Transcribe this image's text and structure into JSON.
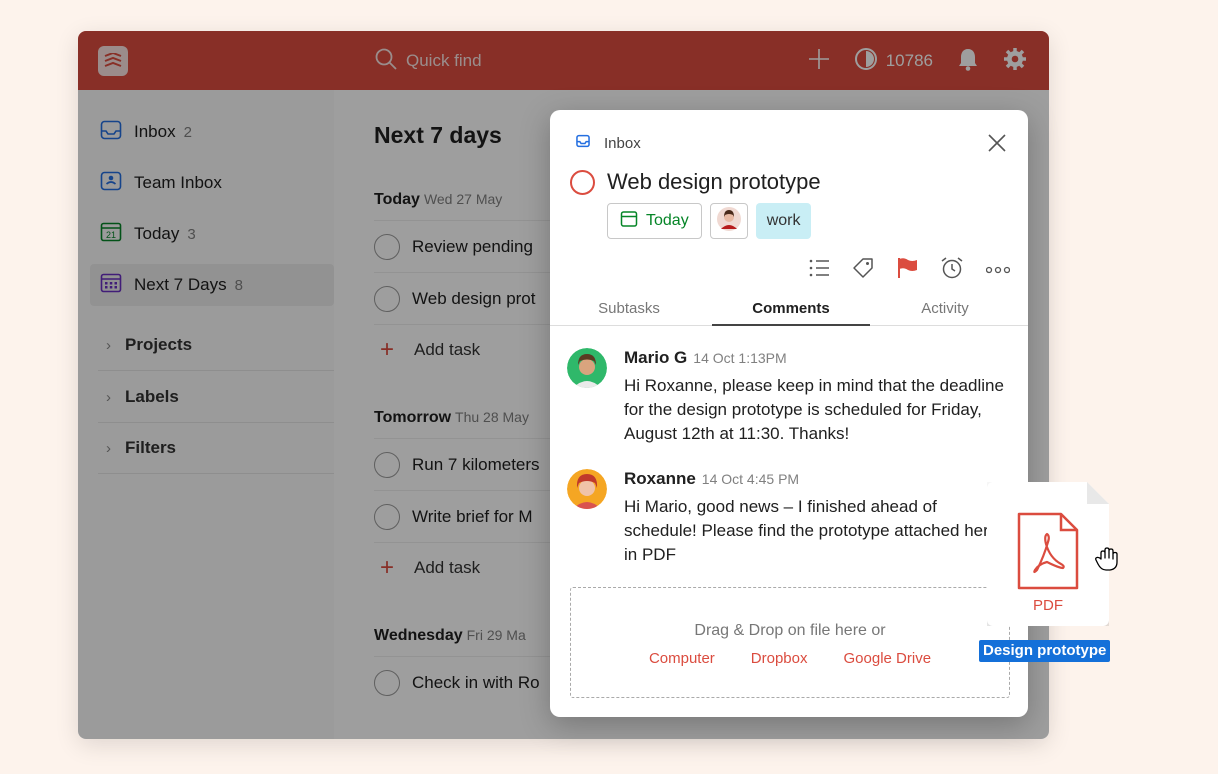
{
  "topbar": {
    "search_placeholder": "Quick find",
    "karma_points": "10786",
    "icons": [
      "app-logo-icon",
      "search-icon",
      "plus-icon",
      "karma-icon",
      "bell-icon",
      "gear-icon"
    ]
  },
  "sidebar": {
    "items": [
      {
        "label": "Inbox",
        "count": "2"
      },
      {
        "label": "Team Inbox",
        "count": ""
      },
      {
        "label": "Today",
        "count": "3"
      },
      {
        "label": "Next 7 Days",
        "count": "8"
      }
    ],
    "groups": [
      "Projects",
      "Labels",
      "Filters"
    ]
  },
  "main": {
    "title": "Next 7 days",
    "days": [
      {
        "name": "Today",
        "date": "Wed 27 May",
        "tasks": [
          "Review pending",
          "Web design prot"
        ]
      },
      {
        "name": "Tomorrow",
        "date": "Thu 28 May",
        "tasks": [
          "Run 7 kilometers",
          "Write brief for M"
        ]
      },
      {
        "name": "Wednesday",
        "date": "Fri 29 Ma",
        "tasks": [
          "Check in with Ro"
        ]
      }
    ],
    "add_task_label": "Add task"
  },
  "modal": {
    "project": "Inbox",
    "task_title": "Web design prototype",
    "due_chip": "Today",
    "label_chip": "work",
    "tabs": [
      "Subtasks",
      "Comments",
      "Activity"
    ],
    "active_tab": "Comments",
    "comments": [
      {
        "author": "Mario G",
        "time": "14 Oct 1:13PM",
        "text": "Hi Roxanne, please keep in mind that the deadline for the design prototype is scheduled for Friday, August 12th at 11:30. Thanks!"
      },
      {
        "author": "Roxanne",
        "time": "14 Oct 4:45 PM",
        "text": "Hi Mario, good news – I finished ahead of schedule! Please find the prototype attached here, in PDF"
      }
    ],
    "dropzone": {
      "title": "Drag & Drop on file here or",
      "links": [
        "Computer",
        "Dropbox",
        "Google Drive"
      ]
    }
  },
  "drag_file": {
    "type_label": "PDF",
    "name": "Design prototype"
  },
  "colors": {
    "brand_red": "#db4c3f",
    "today_green": "#058527",
    "label_bg": "#c9eef5",
    "drag_blue": "#1470d9"
  }
}
